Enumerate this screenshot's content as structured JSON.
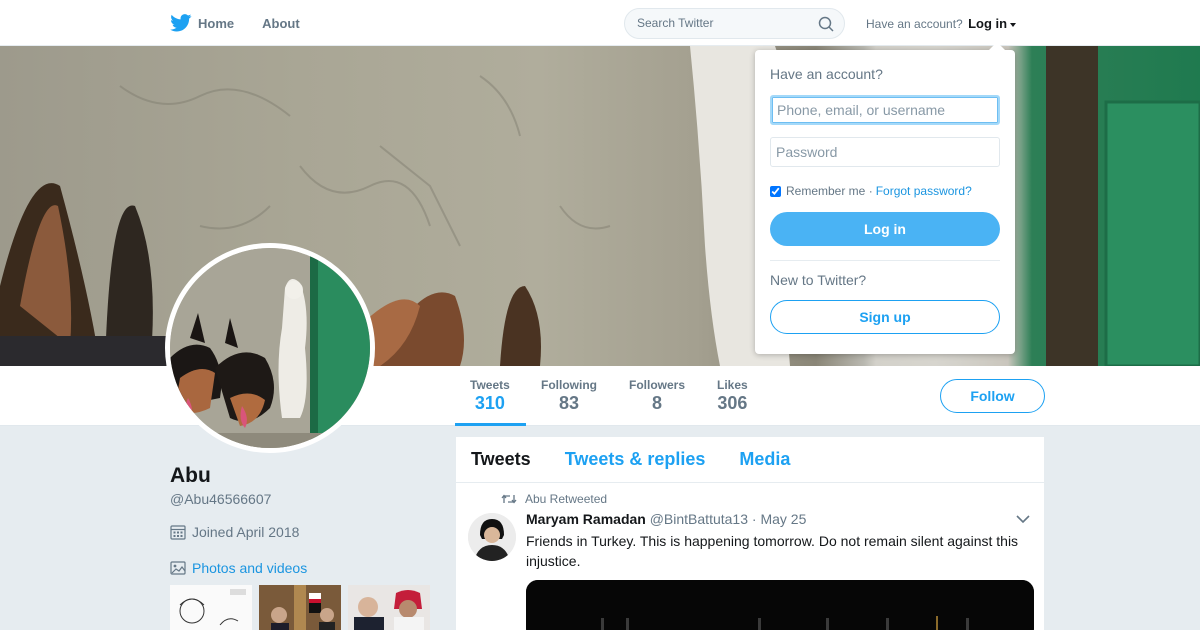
{
  "nav": {
    "home_label": "Home",
    "about_label": "About",
    "search_placeholder": "Search Twitter",
    "account_prompt": "Have an account?",
    "login_label": "Log in"
  },
  "profile": {
    "name": "Abu",
    "handle": "@Abu46566607",
    "joined": "Joined April 2018",
    "photos_label": "Photos and videos"
  },
  "stats": [
    {
      "label": "Tweets",
      "value": "310"
    },
    {
      "label": "Following",
      "value": "83"
    },
    {
      "label": "Followers",
      "value": "8"
    },
    {
      "label": "Likes",
      "value": "306"
    }
  ],
  "follow_label": "Follow",
  "tabs": [
    "Tweets",
    "Tweets & replies",
    "Media"
  ],
  "tweet": {
    "retweeted_by": "Abu Retweeted",
    "author_name": "Maryam Ramadan",
    "author_handle": "@BintBattuta13",
    "date": "· May 25",
    "text": "Friends in Turkey. This is happening tomorrow. Do not remain silent against this injustice."
  },
  "login_panel": {
    "title": "Have an account?",
    "username_placeholder": "Phone, email, or username",
    "password_placeholder": "Password",
    "remember_label": "Remember me",
    "separator": "·",
    "forgot_label": "Forgot password?",
    "login_button": "Log in",
    "new_label": "New to Twitter?",
    "signup_button": "Sign up"
  },
  "colors": {
    "accent": "#1da1f2",
    "login_button": "#4ab3f4",
    "background": "#e6ecf0"
  }
}
